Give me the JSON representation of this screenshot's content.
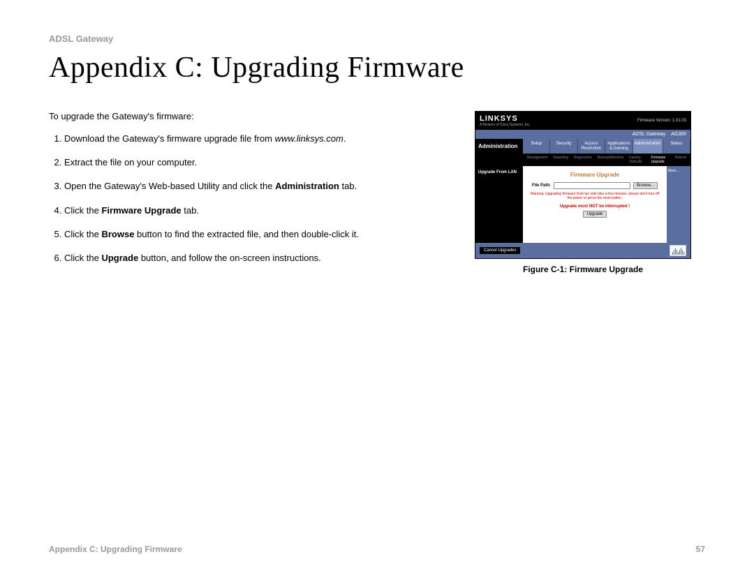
{
  "header": {
    "label": "ADSL Gateway"
  },
  "title": "Appendix C: Upgrading Firmware",
  "intro": "To upgrade the Gateway's firmware:",
  "steps": {
    "s1a": "Download the Gateway's firmware upgrade file from ",
    "s1b": "www.linksys.com",
    "s1c": ".",
    "s2": "Extract the file on your computer.",
    "s3a": "Open the Gateway's Web-based Utility and click the ",
    "s3b": "Administration",
    "s3c": " tab.",
    "s4a": "Click the ",
    "s4b": "Firmware Upgrade",
    "s4c": " tab.",
    "s5a": "Click the ",
    "s5b": "Browse",
    "s5c": " button to find the extracted file, and then double-click it.",
    "s6a": "Click the ",
    "s6b": "Upgrade",
    "s6c": " button, and follow the on-screen instructions."
  },
  "figure": {
    "caption": "Figure C-1: Firmware Upgrade"
  },
  "router": {
    "logo": "LINKSYS",
    "sublogo": "A Division of Cisco Systems, Inc.",
    "fw": "Firmware Version: 1.01.03",
    "breadcrumb1": "ADSL Gateway",
    "breadcrumb2": "AG300",
    "nav_label": "Administration",
    "tabs": [
      "Setup",
      "Security",
      "Access\nRestriction",
      "Applications\n& Gaming",
      "Administration",
      "Status"
    ],
    "subtabs": [
      "Management",
      "Reporting",
      "Diagnostics",
      "Backup&Restore",
      "Factory Defaults",
      "Firmware Upgrade",
      "Reboot"
    ],
    "side": "Upgrade From LAN",
    "heading": "Firmware Upgrade",
    "file_label": "File Path:",
    "browse": "Browse...",
    "warning": "Warning: Upgrading firmware from lan side take a few minutes, please don't turn off the power or press the reset button.",
    "warning2": "Upgrade must NOT be interrupted !",
    "upgrade": "Upgrade",
    "more": "More...",
    "cancel": "Cancel Upgrades"
  },
  "footer": {
    "left": "Appendix C: Upgrading Firmware",
    "right": "57"
  }
}
